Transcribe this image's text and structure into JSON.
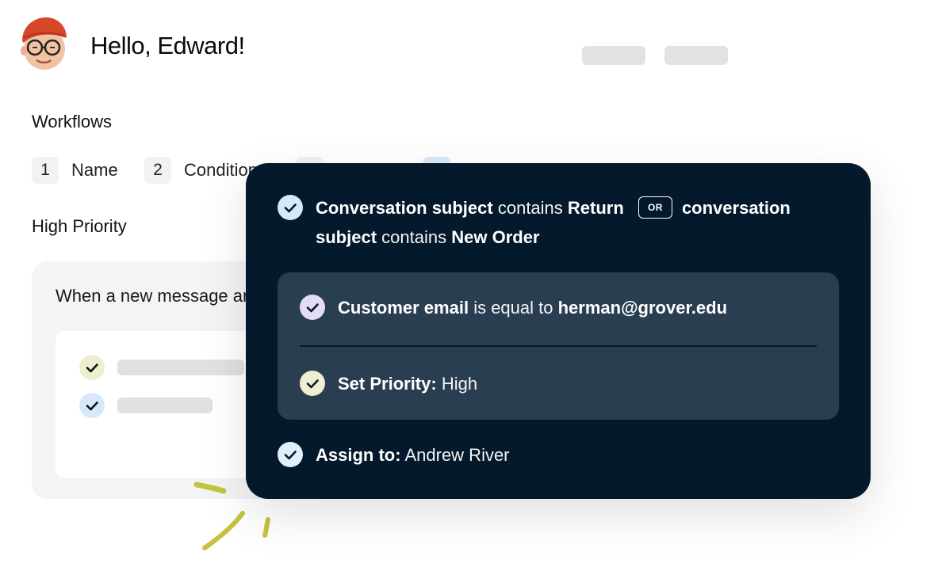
{
  "header": {
    "greeting": "Hello, Edward!",
    "avatar_icon": "memoji-avatar-icon"
  },
  "workflows": {
    "title": "Workflows",
    "steps": [
      {
        "number": "1",
        "label": "Name"
      },
      {
        "number": "2",
        "label": "Condition"
      }
    ],
    "workflow_name": "High Priority"
  },
  "background_card": {
    "trigger_text": "When a new message arrives"
  },
  "conditions_panel": {
    "condition1": {
      "field_a": "Conversation subject",
      "op_a": "contains",
      "value_a": "Return",
      "or_label": "OR",
      "field_b_line1": "conversation",
      "field_b_line2": "subject",
      "op_b": "contains",
      "value_b": "New Order"
    },
    "sub_condition": {
      "field": "Customer email",
      "op": "is equal to",
      "value": "herman@grover.edu"
    },
    "set_priority": {
      "label": "Set Priority:",
      "value": "High"
    },
    "assign": {
      "label": "Assign to:",
      "value": "Andrew River"
    }
  },
  "colors": {
    "panel_bg": "#04192b",
    "subpanel_bg": "#2a3e52",
    "check_blue": "#d7e8fb",
    "check_purple": "#e4dcf5",
    "check_yellow": "#eeeed0",
    "check_lightblue": "#dff0fa",
    "scribble": "#c4c43c"
  }
}
